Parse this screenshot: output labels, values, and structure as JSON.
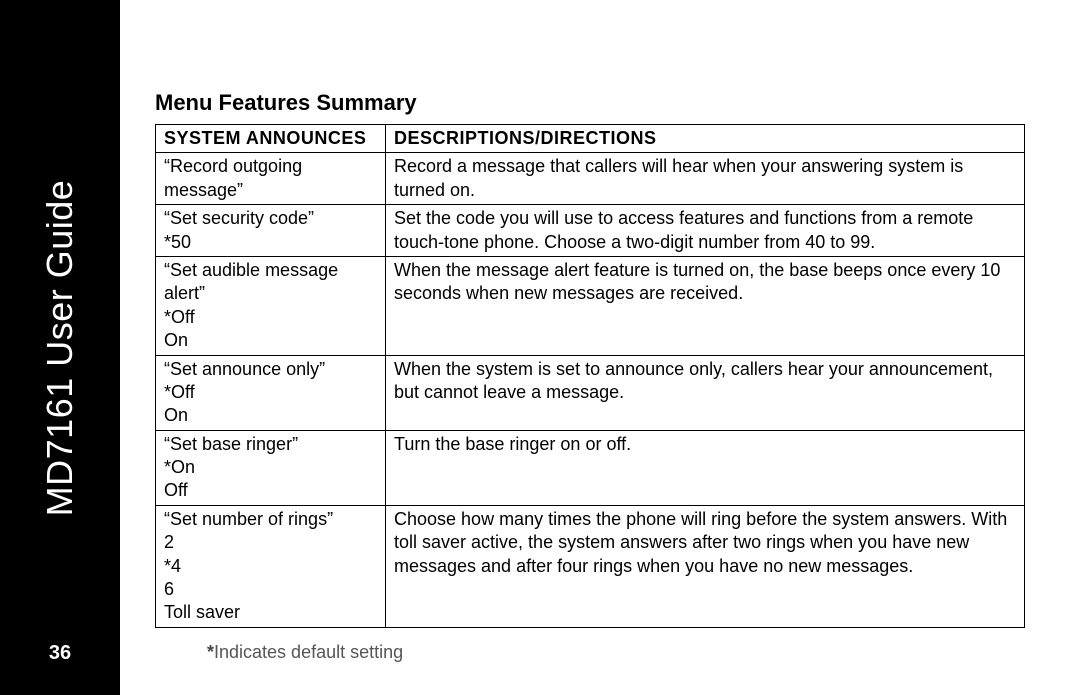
{
  "sidebar": {
    "title": "MD7161 User Guide",
    "page_number": "36"
  },
  "heading": "Menu Features Summary",
  "table": {
    "headers": {
      "col1": "SYSTEM ANNOUNCES",
      "col2": "DESCRIPTIONS/DIRECTIONS"
    },
    "rows": [
      {
        "c1": "“Record outgoing message”",
        "c2": "Record a message that callers will hear when your answering system is turned on."
      },
      {
        "c1": "“Set security code”\n*50",
        "c2": "Set the code you will use to access features and functions from a remote touch-tone phone. Choose a two-digit number from 40 to 99."
      },
      {
        "c1": "“Set audible message alert”\n*Off\nOn",
        "c2": "When the message alert feature is turned on, the base beeps once every 10 seconds when new messages are received."
      },
      {
        "c1": "“Set announce only”\n*Off\nOn",
        "c2": "When the system is set to announce only, callers hear your announcement, but cannot leave a message."
      },
      {
        "c1": "“Set base ringer”\n*On\nOff",
        "c2": "Turn the base ringer on or off."
      },
      {
        "c1": "“Set number of rings”\n2\n*4\n6\nToll saver",
        "c2": "Choose how many times the phone will ring before the system answers. With toll saver active, the system answers after two rings when you have new messages and after four rings when you have no new messages."
      }
    ]
  },
  "footnote": {
    "star": "*",
    "text": "Indicates default setting"
  }
}
